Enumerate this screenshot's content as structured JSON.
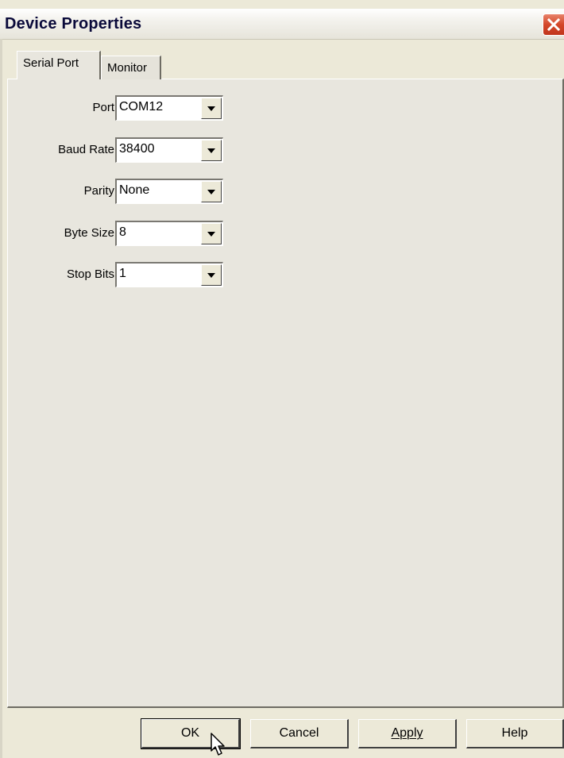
{
  "window": {
    "title": "Device Properties"
  },
  "tabs": [
    {
      "label": "Serial Port",
      "active": true
    },
    {
      "label": "Monitor",
      "active": false
    }
  ],
  "fields": [
    {
      "label": "Port",
      "value": "COM12"
    },
    {
      "label": "Baud Rate",
      "value": "38400"
    },
    {
      "label": "Parity",
      "value": "None"
    },
    {
      "label": "Byte Size",
      "value": "8"
    },
    {
      "label": "Stop Bits",
      "value": "1"
    }
  ],
  "buttons": {
    "ok": "OK",
    "cancel": "Cancel",
    "apply": "Apply",
    "help": "Help"
  },
  "icons": {
    "close": "close-icon",
    "dropdown": "chevron-down-icon",
    "cursor": "mouse-pointer-icon"
  },
  "colors": {
    "face": "#ece9d8",
    "close_button": "#d4472a"
  }
}
